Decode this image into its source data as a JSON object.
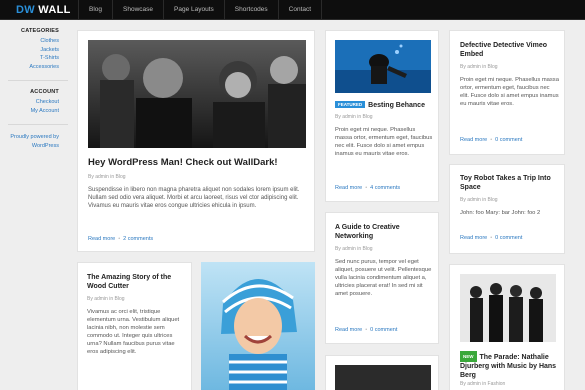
{
  "header": {
    "logo_part1": "DW",
    "logo_part2": "WALL",
    "nav": [
      "Blog",
      "Showcase",
      "Page Layouts",
      "Shortcodes",
      "Contact"
    ]
  },
  "sidebar": {
    "categories_title": "CATEGORIES",
    "categories": [
      "Clothes",
      "Jackets",
      "T-Shirts",
      "Accessories"
    ],
    "account_title": "ACCOUNT",
    "account_links": [
      "Checkout",
      "My Account"
    ],
    "powered_line1": "Proudly powered by",
    "powered_line2": "WordPress"
  },
  "posts": {
    "featured": {
      "title": "Hey WordPress Man! Check out WallDark!",
      "meta": "By admin in Blog",
      "excerpt": "Suspendisse in libero non magna pharetra aliquet non sodales lorem ipsum elit. Nullam sed odio vera aliquet. Morbi et arcu laoreet, risus vel ctor adipiscing elit. Vivamus eu mauris vitae eros congue ultricies ehicula in ipsum.",
      "read_more": "Read more",
      "comments": "2 comments"
    },
    "behance": {
      "badge": "FEATURED",
      "title": "Besting Behance",
      "meta": "By admin in Blog",
      "excerpt": "Proin eget mi neque. Phasellus massa ortor, ermentum eget, faucibus nec elit. Fusce dolo si amet empus inamus eu mauris vitae eros.",
      "read_more": "Read more",
      "comments": "4 comments"
    },
    "creative": {
      "title": "A Guide to Creative Networking",
      "meta": "By admin in Blog",
      "excerpt": "Sed nunc purus, tempor vel eget aliquet, posuere ut velit. Pellentesque vulla lacinia condimentum aliquet a, ultricies placerat erat! In sed mi sit amet posuere.",
      "read_more": "Read more",
      "comments": "0 comment"
    },
    "vimeo": {
      "title": "Defective Detective Vimeo Embed",
      "meta": "By admin in Blog",
      "excerpt": "Proin eget mi neque. Phasellus massa ortor, ermentum eget, faucibus nec elit. Fusce dolo si amet empus inamus eu mauris vitae eros.",
      "read_more": "Read more",
      "comments": "0 comment"
    },
    "robot": {
      "title": "Toy Robot Takes a Trip Into Space",
      "meta": "By admin in Blog",
      "excerpt": "John: foo Mary: bar John: foo 2",
      "read_more": "Read more",
      "comments": "0 comment"
    },
    "woodcutter": {
      "title": "The Amazing Story of the Wood Cutter",
      "meta": "By admin in Blog",
      "excerpt": "Vivamus ac orci elit, tristique elementum urna. Vestibulum aliquet lacinia nibh, non molestie sem commodo ut. Integer quis ultrices urna? Nullam faucibus purus vitae eros adipiscing elit."
    },
    "parade": {
      "badge": "NEW",
      "title": "The Parade: Nathalie Djurberg with Music by Hans Berg",
      "meta": "By admin in Fashion"
    }
  },
  "colors": {
    "accent": "#2a8fd8",
    "featured_badge": "#2a8fd8",
    "new_badge": "#3aa83a"
  }
}
